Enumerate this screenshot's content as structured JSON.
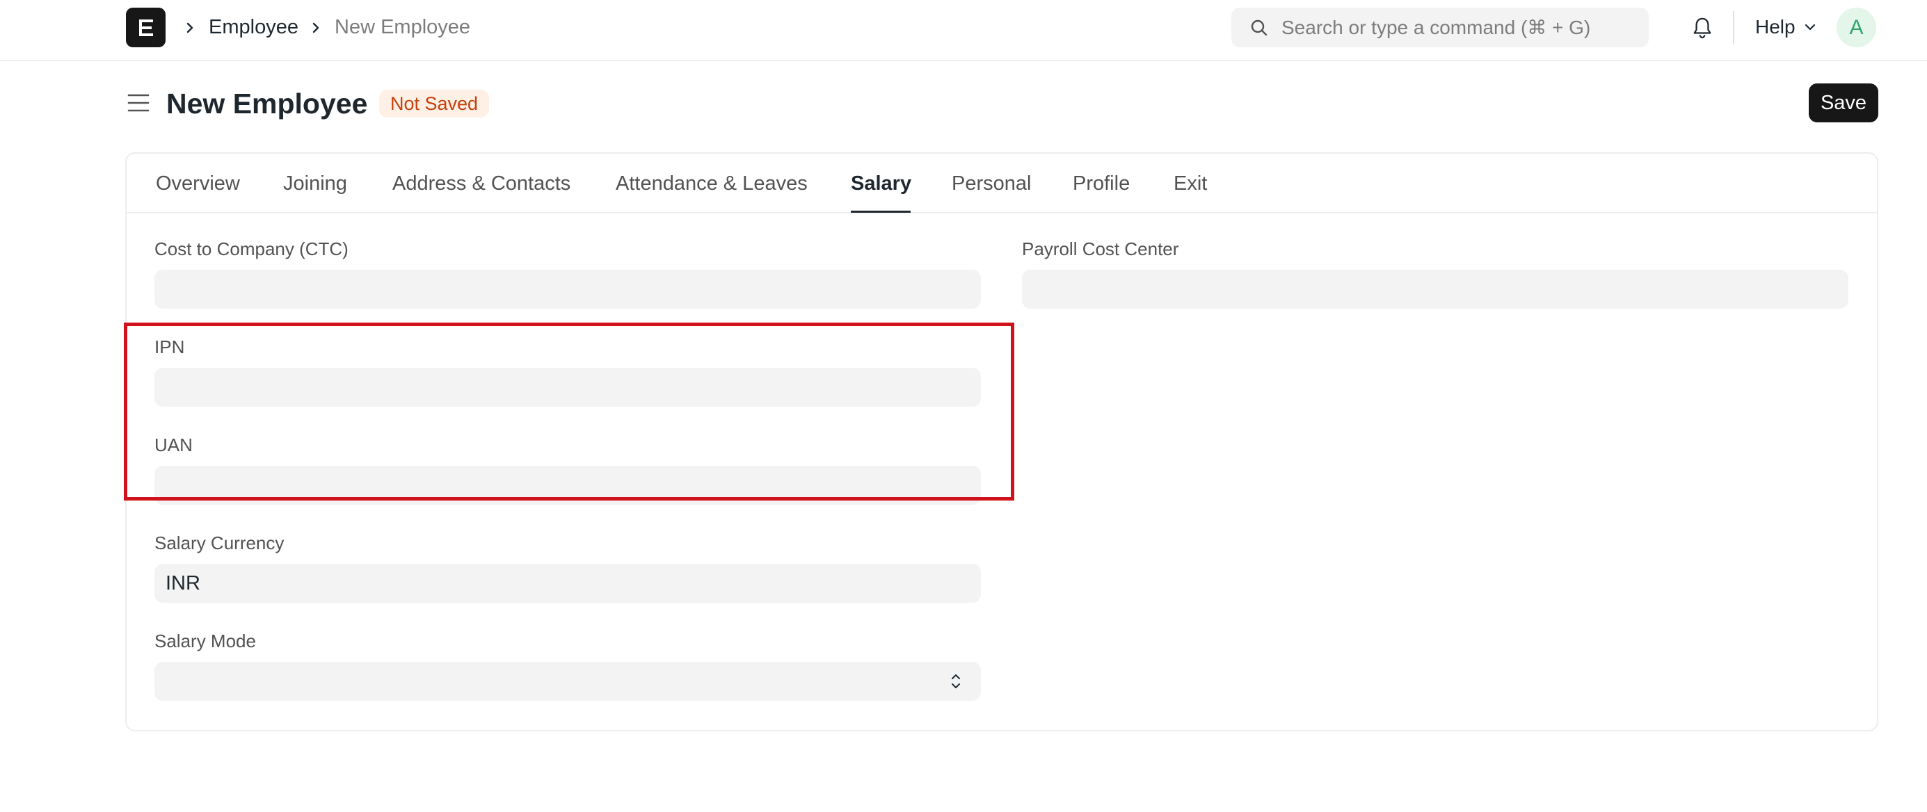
{
  "navbar": {
    "logo_letter": "E",
    "breadcrumbs": [
      {
        "label": "Employee"
      },
      {
        "label": "New Employee"
      }
    ],
    "search": {
      "placeholder": "Search or type a command (⌘ + G)"
    },
    "help_label": "Help",
    "avatar_initial": "A"
  },
  "page": {
    "title": "New Employee",
    "status_badge": "Not Saved",
    "save_label": "Save"
  },
  "tabs": [
    {
      "label": "Overview"
    },
    {
      "label": "Joining"
    },
    {
      "label": "Address & Contacts"
    },
    {
      "label": "Attendance & Leaves"
    },
    {
      "label": "Salary",
      "active": true
    },
    {
      "label": "Personal"
    },
    {
      "label": "Profile"
    },
    {
      "label": "Exit"
    }
  ],
  "form": {
    "ctc": {
      "label": "Cost to Company (CTC)",
      "value": ""
    },
    "payroll_cost_center": {
      "label": "Payroll Cost Center",
      "value": ""
    },
    "ipn": {
      "label": "IPN",
      "value": ""
    },
    "uan": {
      "label": "UAN",
      "value": ""
    },
    "salary_currency": {
      "label": "Salary Currency",
      "value": "INR"
    },
    "salary_mode": {
      "label": "Salary Mode",
      "value": ""
    }
  },
  "colors": {
    "highlight_border": "#d0121a",
    "status_badge_bg": "#fff0e5",
    "status_badge_text": "#c4410c",
    "primary_button": "#171717"
  }
}
